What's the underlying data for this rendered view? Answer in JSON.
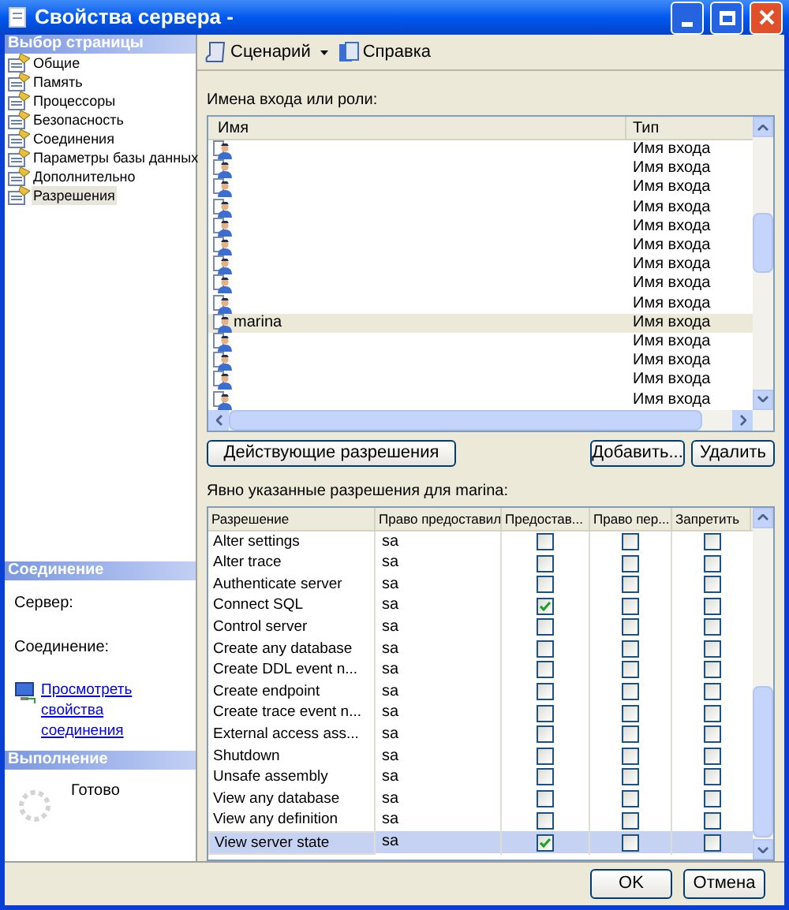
{
  "window": {
    "title": "Свойства сервера -"
  },
  "sidebar": {
    "header": "Выбор страницы",
    "items": [
      {
        "label": "Общие",
        "selected": false
      },
      {
        "label": "Память",
        "selected": false
      },
      {
        "label": "Процессоры",
        "selected": false
      },
      {
        "label": "Безопасность",
        "selected": false
      },
      {
        "label": "Соединения",
        "selected": false
      },
      {
        "label": "Параметры базы данных",
        "selected": false
      },
      {
        "label": "Дополнительно",
        "selected": false
      },
      {
        "label": "Разрешения",
        "selected": true
      }
    ]
  },
  "connection": {
    "header": "Соединение",
    "server_label": "Сервер:",
    "connection_label": "Соединение:",
    "link": "Просмотреть свойства соединения"
  },
  "progress": {
    "header": "Выполнение",
    "status": "Готово"
  },
  "toolbar": [
    {
      "label": "Сценарий",
      "kind": "script",
      "dropdown": true
    },
    {
      "label": "Справка",
      "kind": "help",
      "dropdown": false
    }
  ],
  "logins": {
    "label": "Имена входа или роли:",
    "columns": [
      "Имя",
      "Тип"
    ],
    "rows": [
      {
        "type": "Имя входа",
        "selected": false
      },
      {
        "type": "Имя входа",
        "selected": false
      },
      {
        "type": "Имя входа",
        "selected": false
      },
      {
        "type": "Имя входа",
        "selected": false
      },
      {
        "type": "Имя входа",
        "selected": false
      },
      {
        "type": "Имя входа",
        "selected": false
      },
      {
        "type": "Имя входа",
        "selected": false
      },
      {
        "type": "Имя входа",
        "selected": false
      },
      {
        "type": "Имя входа",
        "selected": false
      },
      {
        "name": "marina",
        "type": "Имя входа",
        "selected": true
      },
      {
        "type": "Имя входа",
        "selected": false
      },
      {
        "type": "Имя входа",
        "selected": false
      },
      {
        "type": "Имя входа",
        "selected": false
      },
      {
        "type": "Имя входа",
        "selected": false
      }
    ]
  },
  "buttons_mid": [
    "Действующие разрешения",
    "Добавить...",
    "Удалить"
  ],
  "permissions": {
    "label": "Явно указанные разрешения для marina:",
    "columns": [
      "Разрешение",
      "Право предоставил",
      "Предостав...",
      "Право пер...",
      "Запретить"
    ],
    "rows": [
      {
        "permission": "Alter settings",
        "grantor": "sa",
        "grant": false,
        "with_grant": false,
        "deny": false,
        "selected": false
      },
      {
        "permission": "Alter trace",
        "grantor": "sa",
        "grant": false,
        "with_grant": false,
        "deny": false,
        "selected": false
      },
      {
        "permission": "Authenticate server",
        "grantor": "sa",
        "grant": false,
        "with_grant": false,
        "deny": false,
        "selected": false
      },
      {
        "permission": "Connect SQL",
        "grantor": "sa",
        "grant": true,
        "with_grant": false,
        "deny": false,
        "selected": false
      },
      {
        "permission": "Control server",
        "grantor": "sa",
        "grant": false,
        "with_grant": false,
        "deny": false,
        "selected": false
      },
      {
        "permission": "Create any database",
        "grantor": "sa",
        "grant": false,
        "with_grant": false,
        "deny": false,
        "selected": false
      },
      {
        "permission": "Create DDL event n...",
        "grantor": "sa",
        "grant": false,
        "with_grant": false,
        "deny": false,
        "selected": false
      },
      {
        "permission": "Create endpoint",
        "grantor": "sa",
        "grant": false,
        "with_grant": false,
        "deny": false,
        "selected": false
      },
      {
        "permission": "Create trace event n...",
        "grantor": "sa",
        "grant": false,
        "with_grant": false,
        "deny": false,
        "selected": false
      },
      {
        "permission": "External access ass...",
        "grantor": "sa",
        "grant": false,
        "with_grant": false,
        "deny": false,
        "selected": false
      },
      {
        "permission": "Shutdown",
        "grantor": "sa",
        "grant": false,
        "with_grant": false,
        "deny": false,
        "selected": false
      },
      {
        "permission": "Unsafe assembly",
        "grantor": "sa",
        "grant": false,
        "with_grant": false,
        "deny": false,
        "selected": false
      },
      {
        "permission": "View any database",
        "grantor": "sa",
        "grant": false,
        "with_grant": false,
        "deny": false,
        "selected": false
      },
      {
        "permission": "View any definition",
        "grantor": "sa",
        "grant": false,
        "with_grant": false,
        "deny": false,
        "selected": false
      },
      {
        "permission": "View server state",
        "grantor": "sa",
        "grant": true,
        "with_grant": false,
        "deny": false,
        "selected": true
      }
    ]
  },
  "buttons_bottom": [
    "OK",
    "Отмена"
  ]
}
